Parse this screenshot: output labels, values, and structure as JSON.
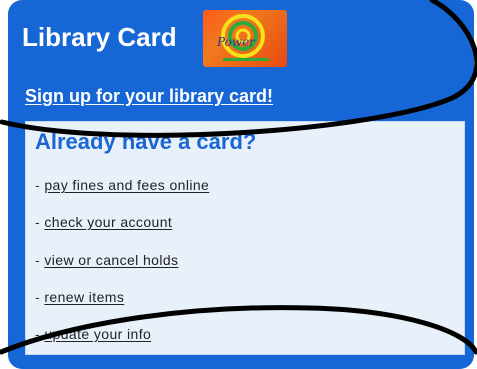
{
  "header": {
    "title": "Library Card",
    "logo_text": "Power"
  },
  "signup": {
    "label": "Sign up for your library card!"
  },
  "account": {
    "heading": "Already have a card?",
    "bullet": "- ",
    "links": [
      "pay fines and fees online",
      "check your account",
      "view or cancel holds",
      "renew items",
      "update your info"
    ]
  },
  "colors": {
    "card_blue": "#1666d6",
    "panel_bg": "#e8f1fa",
    "heading_blue": "#1a66d3"
  }
}
